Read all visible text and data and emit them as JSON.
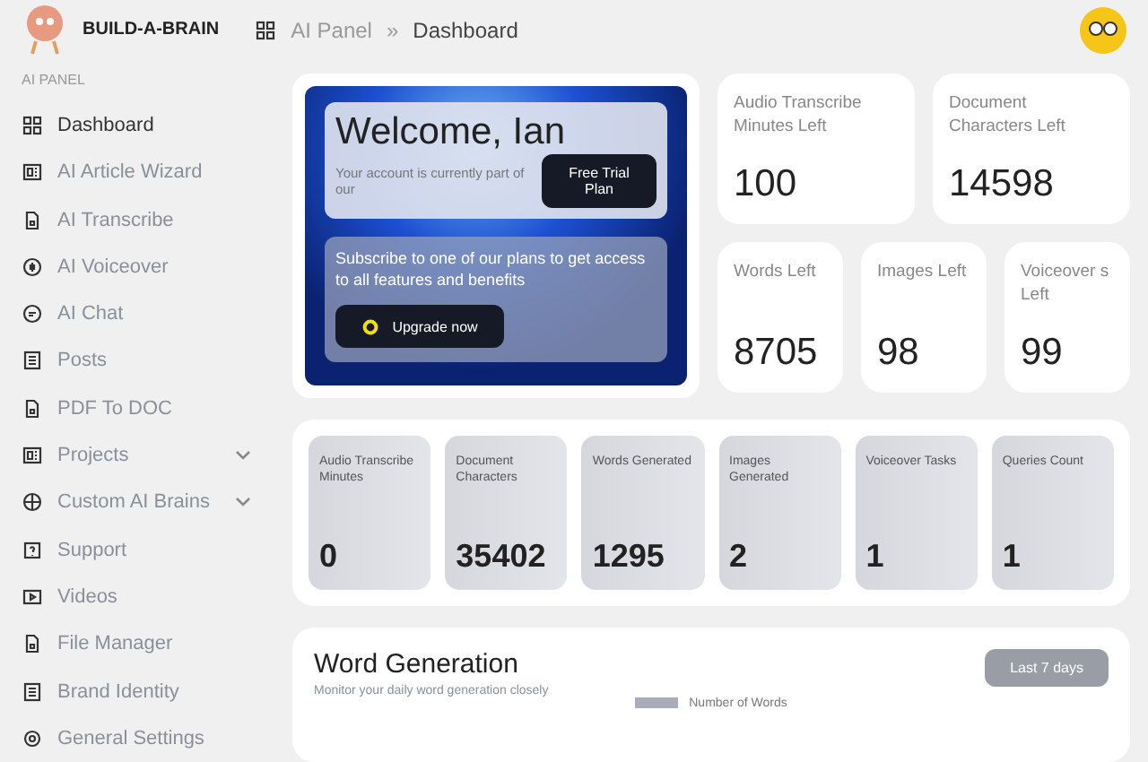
{
  "header": {
    "brand": "BUILD-A-BRAIN",
    "breadcrumb": [
      "AI Panel",
      "Dashboard"
    ],
    "separator": "»"
  },
  "sidebar": {
    "heading": "AI PANEL",
    "items": [
      {
        "label": "Dashboard",
        "selected": true,
        "expandable": false
      },
      {
        "label": "AI Article Wizard",
        "selected": false,
        "expandable": false
      },
      {
        "label": "AI Transcribe",
        "selected": false,
        "expandable": false
      },
      {
        "label": "AI Voiceover",
        "selected": false,
        "expandable": false
      },
      {
        "label": "AI Chat",
        "selected": false,
        "expandable": false
      },
      {
        "label": "Posts",
        "selected": false,
        "expandable": false
      },
      {
        "label": "PDF To DOC",
        "selected": false,
        "expandable": false
      },
      {
        "label": "Projects",
        "selected": false,
        "expandable": true
      },
      {
        "label": "Custom AI Brains",
        "selected": false,
        "expandable": true
      },
      {
        "label": "Support",
        "selected": false,
        "expandable": false
      },
      {
        "label": "Videos",
        "selected": false,
        "expandable": false
      },
      {
        "label": "File Manager",
        "selected": false,
        "expandable": false
      },
      {
        "label": "Brand Identity",
        "selected": false,
        "expandable": false
      },
      {
        "label": "General Settings",
        "selected": false,
        "expandable": false
      }
    ]
  },
  "welcome": {
    "title": "Welcome, Ian",
    "text": "Your account is currently part of our",
    "plan_button": "Free Trial Plan",
    "promo": "Subscribe to one of our plans to get access to all features and benefits",
    "upgrade_button": "Upgrade now"
  },
  "quota_cards": [
    {
      "label": "Audio Transcribe Minutes Left",
      "value": "100"
    },
    {
      "label": "Document Characters Left",
      "value": "14598"
    },
    {
      "label": "Words Left",
      "value": "8705"
    },
    {
      "label": "Images Left",
      "value": "98"
    },
    {
      "label": "Voiceover s Left",
      "value": "99"
    }
  ],
  "usage_cards": [
    {
      "label": "Audio Transcribe Minutes",
      "value": "0"
    },
    {
      "label": "Document Characters",
      "value": "35402"
    },
    {
      "label": "Words Generated",
      "value": "1295"
    },
    {
      "label": "Images Generated",
      "value": "2"
    },
    {
      "label": "Voiceover Tasks",
      "value": "1"
    },
    {
      "label": "Queries Count",
      "value": "1"
    }
  ],
  "word_generation": {
    "title": "Word Generation",
    "subtitle": "Monitor your daily word generation closely",
    "range_button": "Last 7 days",
    "legend": "Number of Words"
  }
}
